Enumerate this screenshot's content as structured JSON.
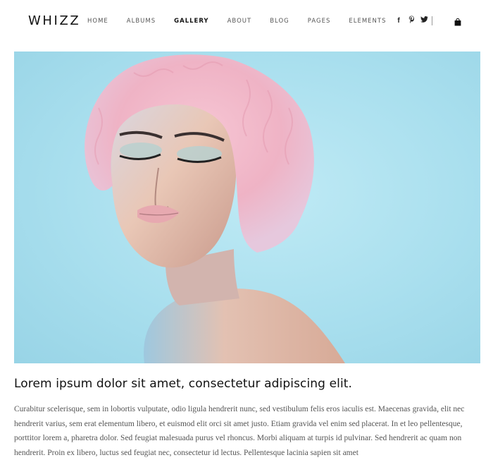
{
  "brand": {
    "logo": "WHIZZ"
  },
  "nav": {
    "items": [
      {
        "label": "HOME",
        "active": false
      },
      {
        "label": "ALBUMS",
        "active": false
      },
      {
        "label": "GALLERY",
        "active": true
      },
      {
        "label": "ABOUT",
        "active": false
      },
      {
        "label": "BLOG",
        "active": false
      },
      {
        "label": "PAGES",
        "active": false
      },
      {
        "label": "ELEMENTS",
        "active": false
      }
    ]
  },
  "social": {
    "facebook": "f",
    "pinterest": "𝒫",
    "twitter": "🐦"
  },
  "cart": {
    "icon": "shopping-bag-icon"
  },
  "hero": {
    "description_icon": "portrait-photo",
    "colors": {
      "background": "#a9dfee",
      "hair": "#f0b8c8",
      "skin": "#e7c3b3"
    }
  },
  "post": {
    "title": "Lorem ipsum dolor sit amet, consectetur adipiscing elit.",
    "body": "Curabitur scelerisque, sem in lobortis vulputate, odio ligula hendrerit nunc, sed vestibulum felis eros iaculis est. Maecenas gravida, elit nec hendrerit varius, sem erat elementum libero, et euismod elit orci sit amet justo. Etiam gravida vel enim sed placerat. In et leo pellentesque, porttitor lorem a, pharetra dolor. Sed feugiat malesuada purus vel rhoncus. Morbi aliquam at turpis id pulvinar. Sed hendrerit ac quam non hendrerit. Proin ex libero, luctus sed feugiat nec, consectetur id lectus. Pellentesque lacinia sapien sit amet"
  }
}
